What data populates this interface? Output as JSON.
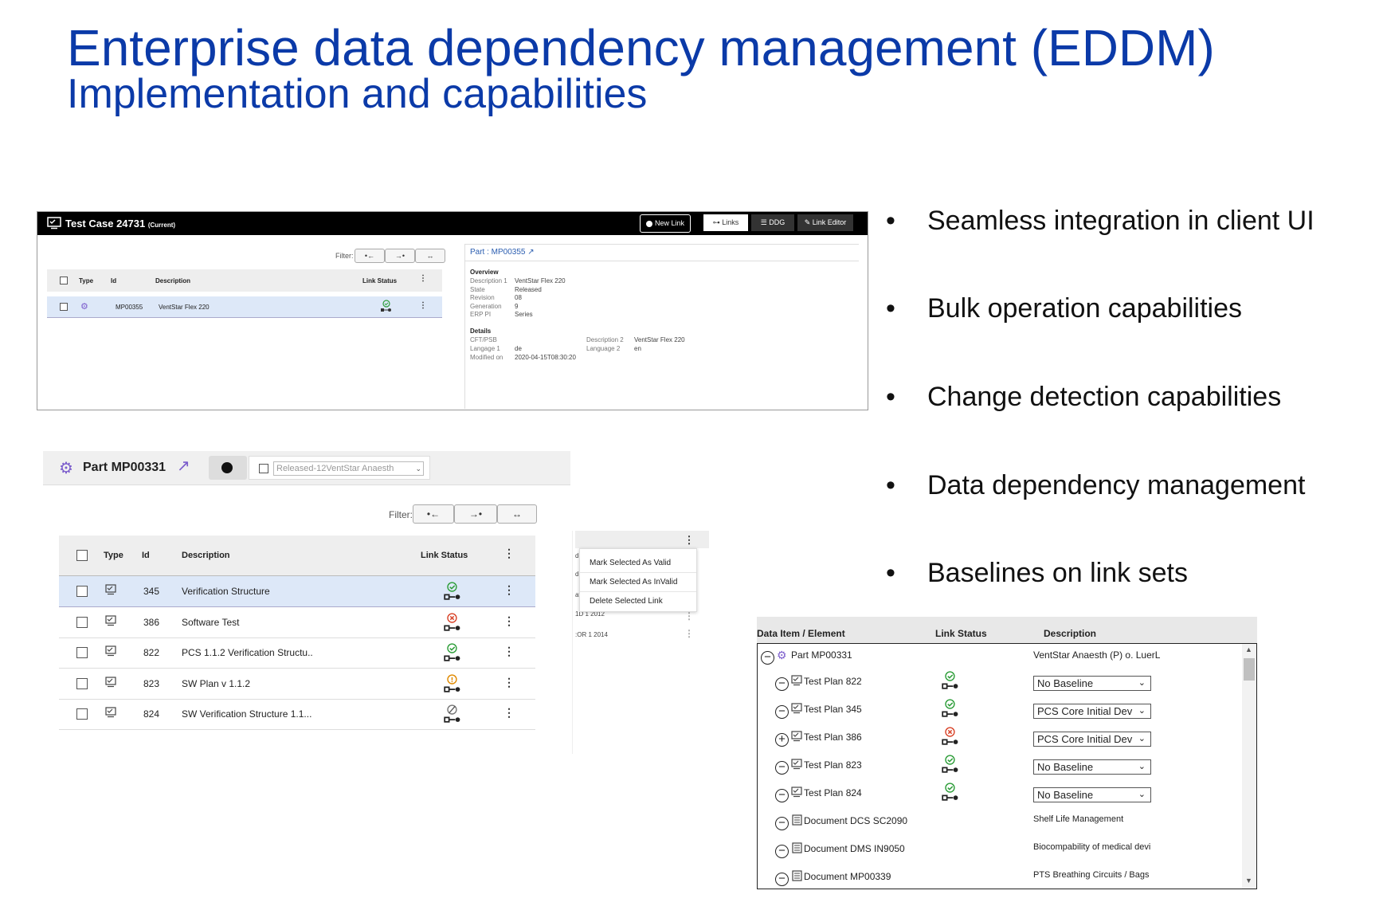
{
  "slide": {
    "title": "Enterprise data dependency management (EDDM)",
    "subtitle": "Implementation and capabilities"
  },
  "bullets": [
    "Seamless integration in client UI",
    "Bulk operation capabilities",
    "Change detection capabilities",
    "Data dependency management",
    "Baselines on link sets"
  ],
  "panel1": {
    "title": "Test Case 24731",
    "title_tag": "(Current)",
    "buttons": {
      "new_link": "New Link",
      "links": "Links",
      "ddg": "DDG",
      "link_editor": "Link Editor"
    },
    "filter_label": "Filter:",
    "filter_buttons": [
      "•←",
      "→•",
      "↔"
    ],
    "columns": {
      "type": "Type",
      "id": "Id",
      "description": "Description",
      "link_status": "Link Status"
    },
    "row": {
      "id": "MP00355",
      "description": "VentStar Flex 220"
    },
    "part_title": "Part : MP00355",
    "overview_label": "Overview",
    "overview": [
      {
        "k": "Description 1",
        "v": "VentStar Flex 220"
      },
      {
        "k": "State",
        "v": "Released"
      },
      {
        "k": "Revision",
        "v": "08"
      },
      {
        "k": "Generation",
        "v": "9"
      },
      {
        "k": "ERP PI",
        "v": "Series"
      }
    ],
    "details_label": "Details",
    "details_left": [
      {
        "k": "CFT/PSB",
        "v": ""
      },
      {
        "k": "Langage 1",
        "v": "de"
      },
      {
        "k": "Modified on",
        "v": "2020-04-15T08:30:20"
      }
    ],
    "details_right": [
      {
        "k": "Description 2",
        "v": "VentStar Flex 220"
      },
      {
        "k": "Language 2",
        "v": "en"
      }
    ]
  },
  "panel2": {
    "part_title": "Part MP00331",
    "baseline_select": "Released-12VentStar Anaesth",
    "filter_label": "Filter:",
    "filter_buttons": [
      "•←",
      "→•",
      "↔"
    ],
    "columns": {
      "type": "Type",
      "id": "Id",
      "description": "Description",
      "link_status": "Link Status"
    },
    "rows": [
      {
        "id": "345",
        "description": "Verification Structure",
        "status": "valid"
      },
      {
        "id": "386",
        "description": "Software Test",
        "status": "invalid"
      },
      {
        "id": "822",
        "description": "PCS 1.1.2 Verification Structu..",
        "status": "valid"
      },
      {
        "id": "823",
        "description": "SW Plan v 1.1.2",
        "status": "warning"
      },
      {
        "id": "824",
        "description": "SW Verification Structure 1.1...",
        "status": "none"
      }
    ],
    "context_menu": [
      "Mark Selected As Valid",
      "Mark Selected As InValid",
      "Delete Selected Link"
    ],
    "bg_fragments": [
      "d",
      "d",
      "af",
      "1D 1 2012",
      ":OR 1 2014"
    ]
  },
  "panel3": {
    "columns": {
      "item": "Data Item / Element",
      "status": "Link Status",
      "description": "Description"
    },
    "root": {
      "label": "Part MP00331",
      "description": "VentStar Anaesth (P) o. LuerL"
    },
    "items": [
      {
        "label": "Test Plan 822",
        "toggle": "−",
        "status": "valid",
        "baseline": "No Baseline"
      },
      {
        "label": "Test Plan 345",
        "toggle": "−",
        "status": "valid",
        "baseline": "PCS Core Initial Dev"
      },
      {
        "label": "Test Plan 386",
        "toggle": "+",
        "status": "invalid",
        "baseline": "PCS Core Initial Dev"
      },
      {
        "label": "Test Plan 823",
        "toggle": "−",
        "status": "valid",
        "baseline": "No Baseline"
      },
      {
        "label": "Test Plan 824",
        "toggle": "−",
        "status": "valid",
        "baseline": "No Baseline"
      }
    ],
    "documents": [
      {
        "label": "Document DCS SC2090",
        "description": "Shelf Life Management"
      },
      {
        "label": "Document DMS IN9050",
        "description": "Biocompability of medical devi"
      },
      {
        "label": "Document MP00339",
        "description": "PTS Breathing Circuits / Bags"
      }
    ]
  },
  "colors": {
    "title_blue": "#0b3aa8",
    "valid": "#2e9e3a",
    "invalid": "#d9452b",
    "warning": "#e08a00",
    "selected_row": "#dde8f8",
    "part_icon": "#7b5ccc"
  }
}
